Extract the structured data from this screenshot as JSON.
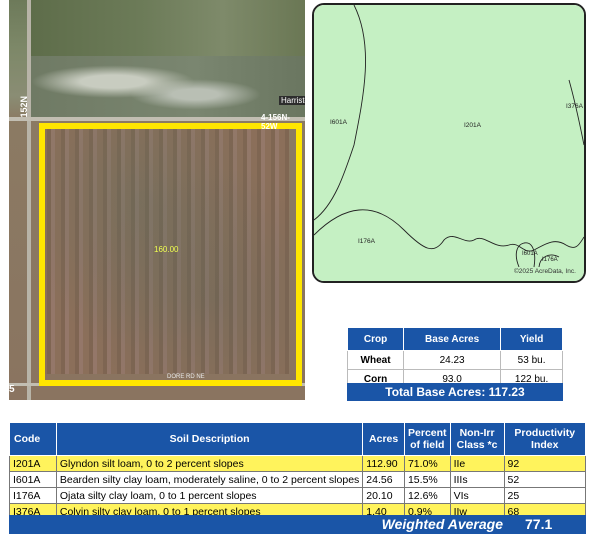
{
  "aerial": {
    "acres_label": "160.00",
    "road_label_vertical": "152N",
    "road_label_horizontal": "4-156N-52W",
    "town_label": "Harriston",
    "corner_label": "5",
    "bottom_road_label": "DORE RD NE"
  },
  "soil_map": {
    "labels": [
      "I601A",
      "I201A",
      "I376A",
      "I176A",
      "I601A",
      "I176A"
    ],
    "credit": "©2025 AcreData, Inc.",
    "fill_color": "#c5f0c3"
  },
  "crop_table": {
    "headers": [
      "Crop",
      "Base Acres",
      "Yield"
    ],
    "rows": [
      {
        "crop": "Wheat",
        "base_acres": "24.23",
        "yield": "53 bu."
      },
      {
        "crop": "Corn",
        "base_acres": "93.0",
        "yield": "122 bu."
      }
    ],
    "total_label": "Total Base Acres:  117.23"
  },
  "soil_table": {
    "headers": [
      "Code",
      "Soil Description",
      "Acres",
      "Percent of field",
      "Non-Irr Class *c",
      "Productivity Index"
    ],
    "rows": [
      {
        "code": "I201A",
        "description": "Glyndon silt loam, 0 to 2 percent slopes",
        "acres": "112.90",
        "percent": "71.0%",
        "class": "IIe",
        "index": "92"
      },
      {
        "code": "I601A",
        "description": "Bearden silty clay loam, moderately saline, 0 to 2 percent slopes",
        "acres": "24.56",
        "percent": "15.5%",
        "class": "IIIs",
        "index": "52"
      },
      {
        "code": "I176A",
        "description": "Ojata silty clay loam, 0 to 1 percent slopes",
        "acres": "20.10",
        "percent": "12.6%",
        "class": "VIs",
        "index": "25"
      },
      {
        "code": "I376A",
        "description": "Colvin silty clay loam, 0 to 1 percent slopes",
        "acres": "1.40",
        "percent": "0.9%",
        "class": "IIw",
        "index": "68"
      }
    ],
    "weighted_label": "Weighted Average",
    "weighted_value": "77.1"
  },
  "colors": {
    "header_blue": "#1a55a7",
    "highlight_yellow": "#fff35c",
    "boundary_yellow": "#ffe600"
  }
}
